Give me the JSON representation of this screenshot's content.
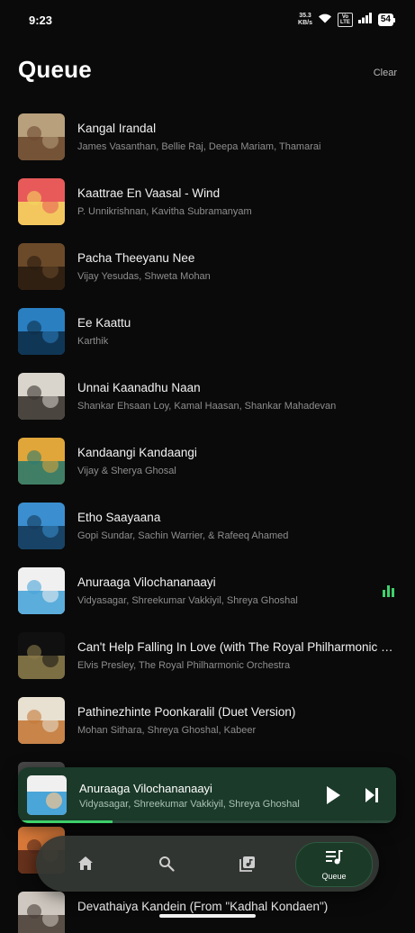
{
  "status_bar": {
    "time": "9:23",
    "net_speed": "35.3",
    "net_unit": "KB/s",
    "volte_top": "Vo",
    "volte_bottom": "LTE",
    "battery": "54"
  },
  "header": {
    "title": "Queue",
    "clear_label": "Clear"
  },
  "queue": [
    {
      "title": "Kangal Irandal",
      "artist": "James Vasanthan, Bellie Raj, Deepa Mariam, Thamarai",
      "art_colors": [
        "#b8a07c",
        "#6e4a30"
      ]
    },
    {
      "title": "Kaattrae En Vaasal - Wind",
      "artist": "P. Unnikrishnan, Kavitha Subramanyam",
      "art_colors": [
        "#e85a5a",
        "#f4d35e"
      ]
    },
    {
      "title": "Pacha Theeyanu Nee",
      "artist": "Vijay Yesudas, Shweta Mohan",
      "art_colors": [
        "#6b4a2a",
        "#2a1c10"
      ]
    },
    {
      "title": "Ee Kaattu",
      "artist": "Karthik",
      "art_colors": [
        "#2a7fc1",
        "#0d2f4a"
      ]
    },
    {
      "title": "Unnai Kaanadhu Naan",
      "artist": "Shankar Ehsaan Loy, Kamal Haasan, Shankar Mahadevan",
      "art_colors": [
        "#d9d4cc",
        "#3a3530"
      ]
    },
    {
      "title": "Kandaangi Kandaangi",
      "artist": "Vijay & Sherya Ghosal",
      "art_colors": [
        "#e0a63a",
        "#2f7b6c"
      ]
    },
    {
      "title": "Etho Saayaana",
      "artist": "Gopi Sundar, Sachin Warrier, & Rafeeq Ahamed",
      "art_colors": [
        "#3b8fd0",
        "#153b5a"
      ]
    },
    {
      "title": "Anuraaga Vilochananaayi",
      "artist": "Vidyasagar, Shreekumar Vakkiyil, Shreya Ghoshal",
      "art_colors": [
        "#f0f0f0",
        "#4aa5d8"
      ],
      "playing": true
    },
    {
      "title": "Can't Help Falling In Love (with The Royal Philharmonic Orchestra)",
      "artist": "Elvis Presley, The Royal Philharmonic Orchestra",
      "art_colors": [
        "#101010",
        "#8a7a4a"
      ]
    },
    {
      "title": "Pathinezhinte Poonkaralil (Duet Version)",
      "artist": "Mohan Sithara, Shreya Ghoshal, Kabeer",
      "art_colors": [
        "#e8e0d0",
        "#c47a3a"
      ]
    },
    {
      "title": "",
      "artist": "",
      "art_colors": [
        "#4a4a4a",
        "#222222"
      ]
    },
    {
      "title": "",
      "artist": "",
      "art_colors": [
        "#d97a3a",
        "#5a2a1a"
      ]
    },
    {
      "title": "Devathaiya Kandein (From \"Kadhal Kondaen\")",
      "artist": "",
      "art_colors": [
        "#cfc8c0",
        "#4a4038"
      ]
    }
  ],
  "now_playing": {
    "title": "Anuraaga Vilochananaayi",
    "artist": "Vidyasagar, Shreekumar Vakkiyil, Shreya Ghoshal",
    "progress": 0.25,
    "art_colors": [
      "#f0f0f0",
      "#4aa5d8"
    ]
  },
  "bottom_nav": {
    "items": [
      {
        "icon": "home-icon"
      },
      {
        "icon": "search-icon"
      },
      {
        "icon": "library-icon"
      },
      {
        "icon": "queue-icon",
        "label": "Queue",
        "active": true
      }
    ]
  },
  "colors": {
    "accent": "#3fd26b",
    "background": "#0a0a0a",
    "mini_player_bg": "#1b3a2a"
  }
}
